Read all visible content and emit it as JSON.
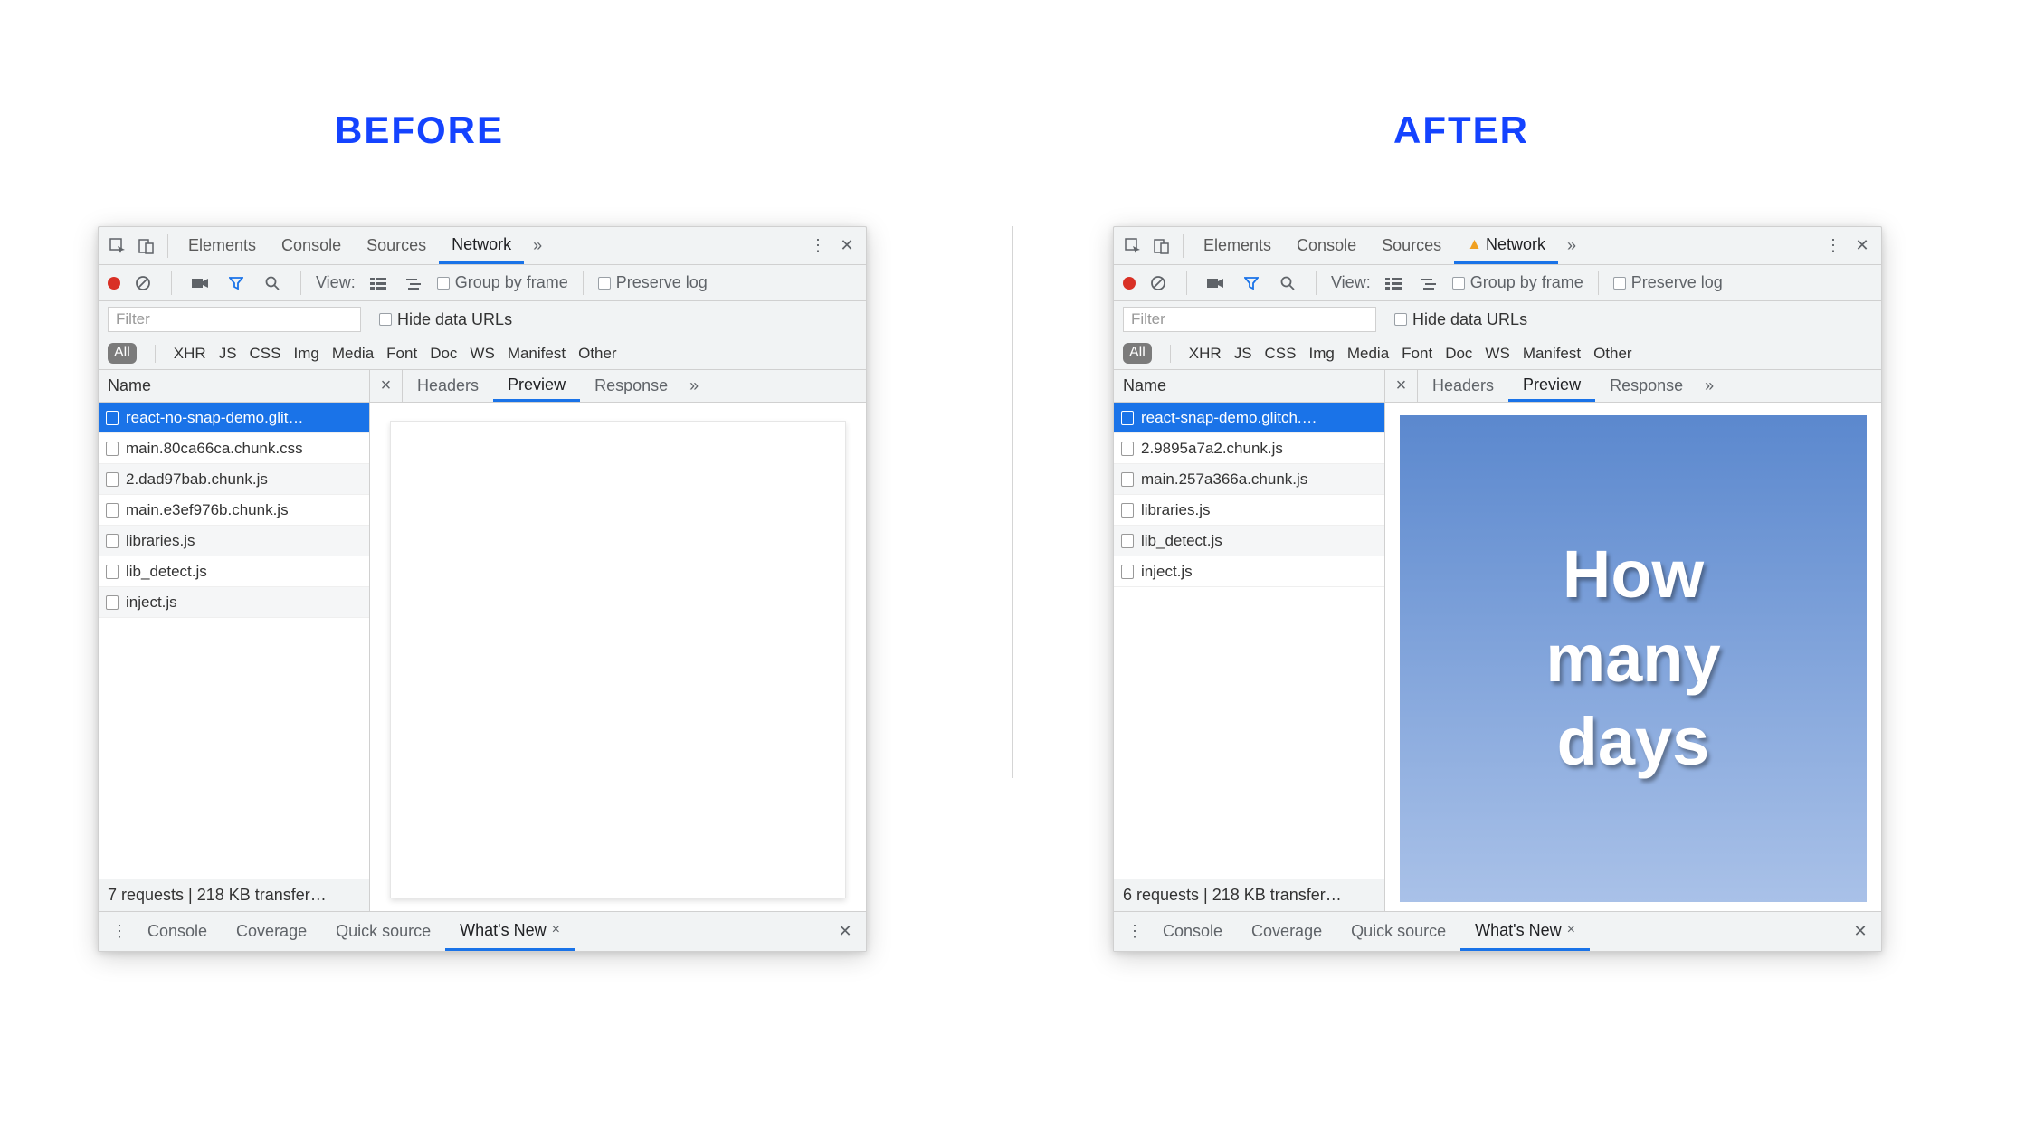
{
  "titles": {
    "before": "BEFORE",
    "after": "AFTER"
  },
  "tabs": {
    "elements": "Elements",
    "console": "Console",
    "sources": "Sources",
    "network": "Network"
  },
  "toolbar": {
    "view": "View:",
    "group_by_frame": "Group by frame",
    "preserve_log": "Preserve log"
  },
  "filter": {
    "placeholder": "Filter",
    "hide_data_urls": "Hide data URLs"
  },
  "types": {
    "all": "All",
    "items": [
      "XHR",
      "JS",
      "CSS",
      "Img",
      "Media",
      "Font",
      "Doc",
      "WS",
      "Manifest",
      "Other"
    ]
  },
  "detail_tabs": {
    "headers": "Headers",
    "preview": "Preview",
    "response": "Response"
  },
  "col_header": "Name",
  "before": {
    "requests": [
      "react-no-snap-demo.glit…",
      "main.80ca66ca.chunk.css",
      "2.dad97bab.chunk.js",
      "main.e3ef976b.chunk.js",
      "libraries.js",
      "lib_detect.js",
      "inject.js"
    ],
    "status": "7 requests | 218 KB transfer…"
  },
  "after": {
    "requests": [
      "react-snap-demo.glitch.…",
      "2.9895a7a2.chunk.js",
      "main.257a366a.chunk.js",
      "libraries.js",
      "lib_detect.js",
      "inject.js"
    ],
    "status": "6 requests | 218 KB transfer…",
    "preview_text": [
      "How",
      "many",
      "days"
    ]
  },
  "drawer": {
    "console": "Console",
    "coverage": "Coverage",
    "quick_source": "Quick source",
    "whats_new": "What's New"
  }
}
